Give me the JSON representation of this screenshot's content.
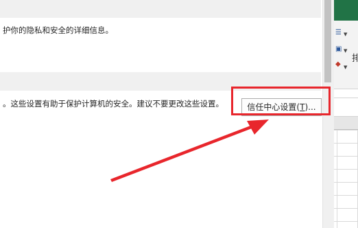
{
  "options": {
    "privacy_description": "护你的隐私和安全的详细信息。",
    "trust_center_description": "。这些设置有助于保护计算机的安全。建议不要更改这些设置。",
    "trust_center_button": {
      "label": "信任中心设置(",
      "accelerator": "T",
      "label_suffix": ")..."
    }
  },
  "excel": {
    "ribbon_partial_text": "排"
  },
  "annotation": {
    "highlight_color": "#e8262c"
  },
  "colors": {
    "section_header_bg": "#f0f0f0",
    "excel_green": "#217346"
  }
}
